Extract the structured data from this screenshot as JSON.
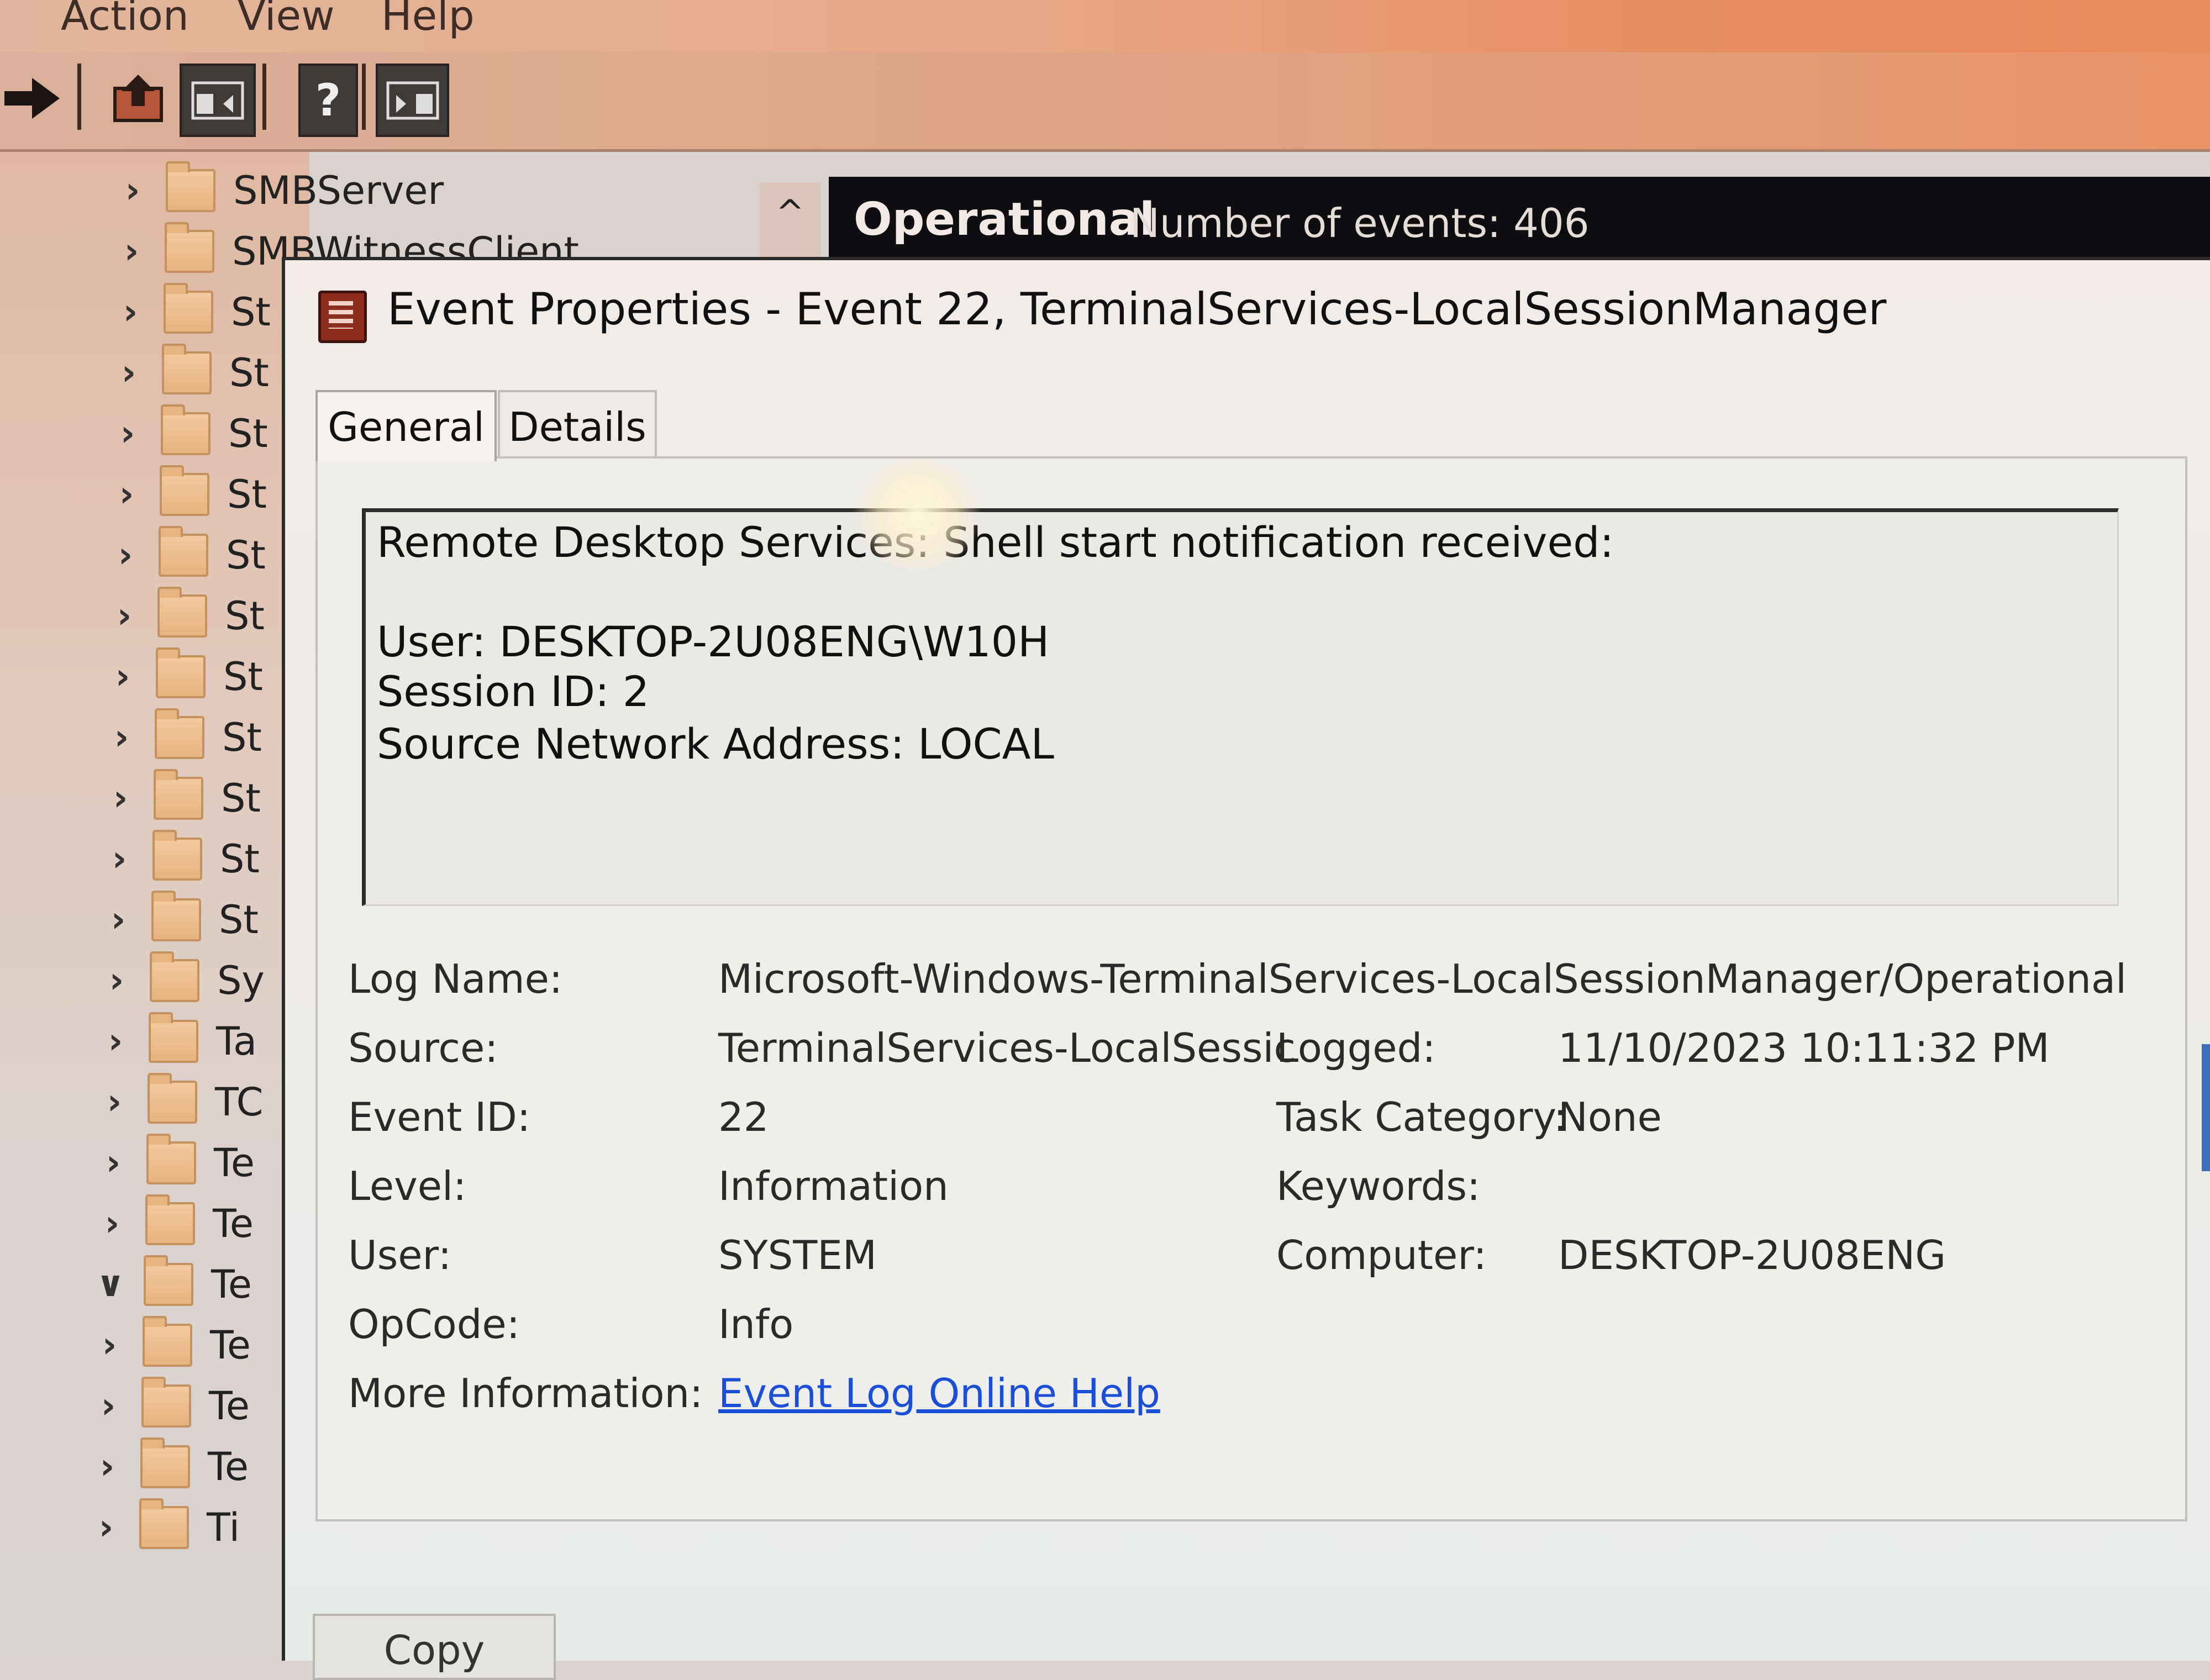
{
  "menu": {
    "items": [
      "Action",
      "View",
      "Help"
    ]
  },
  "toolbar": {
    "buttons": [
      "forward-icon",
      "up-folder-icon",
      "show-hide-icon",
      "help-icon",
      "action-pane-icon"
    ],
    "help_glyph": "?"
  },
  "tree": {
    "items": [
      {
        "label": "SMBServer",
        "expanded": false
      },
      {
        "label": "SMBWitnessClient",
        "expanded": false
      },
      {
        "label": "St",
        "expanded": false
      },
      {
        "label": "St",
        "expanded": false
      },
      {
        "label": "St",
        "expanded": false
      },
      {
        "label": "St",
        "expanded": false
      },
      {
        "label": "St",
        "expanded": false
      },
      {
        "label": "St",
        "expanded": false
      },
      {
        "label": "St",
        "expanded": false
      },
      {
        "label": "St",
        "expanded": false
      },
      {
        "label": "St",
        "expanded": false
      },
      {
        "label": "St",
        "expanded": false
      },
      {
        "label": "St",
        "expanded": false
      },
      {
        "label": "Sy",
        "expanded": false
      },
      {
        "label": "Ta",
        "expanded": false
      },
      {
        "label": "TC",
        "expanded": false
      },
      {
        "label": "Te",
        "expanded": false
      },
      {
        "label": "Te",
        "expanded": false
      },
      {
        "label": "Te",
        "expanded": true
      },
      {
        "label": "Te",
        "expanded": false
      },
      {
        "label": "Te",
        "expanded": false
      },
      {
        "label": "Te",
        "expanded": false
      },
      {
        "label": "Ti",
        "expanded": false
      }
    ],
    "scroll_up_glyph": "^"
  },
  "log_header": {
    "title": "Operational",
    "count": "Number of events: 406"
  },
  "dialog": {
    "title": "Event Properties - Event 22, TerminalServices-LocalSessionManager",
    "tabs": [
      {
        "label": "General",
        "active": true
      },
      {
        "label": "Details",
        "active": false
      }
    ],
    "message": {
      "line1": "Remote Desktop Services: Shell start notification received:",
      "line2": "User: DESKTOP-2U08ENG\\W10H",
      "line3": "Session ID: 2",
      "line4": "Source Network Address: LOCAL"
    },
    "fields": {
      "log_name_label": "Log Name:",
      "log_name_value": "Microsoft-Windows-TerminalServices-LocalSessionManager/Operational",
      "source_label": "Source:",
      "source_value": "TerminalServices-LocalSessic",
      "logged_label": "Logged:",
      "logged_value": "11/10/2023 10:11:32 PM",
      "event_id_label": "Event ID:",
      "event_id_value": "22",
      "task_category_label": "Task Category:",
      "task_category_value": "None",
      "level_label": "Level:",
      "level_value": "Information",
      "keywords_label": "Keywords:",
      "keywords_value": "",
      "user_label": "User:",
      "user_value": "SYSTEM",
      "computer_label": "Computer:",
      "computer_value": "DESKTOP-2U08ENG",
      "opcode_label": "OpCode:",
      "opcode_value": "Info",
      "more_info_label": "More Information:",
      "more_info_link": "Event Log Online Help"
    },
    "copy_label": "Copy"
  }
}
